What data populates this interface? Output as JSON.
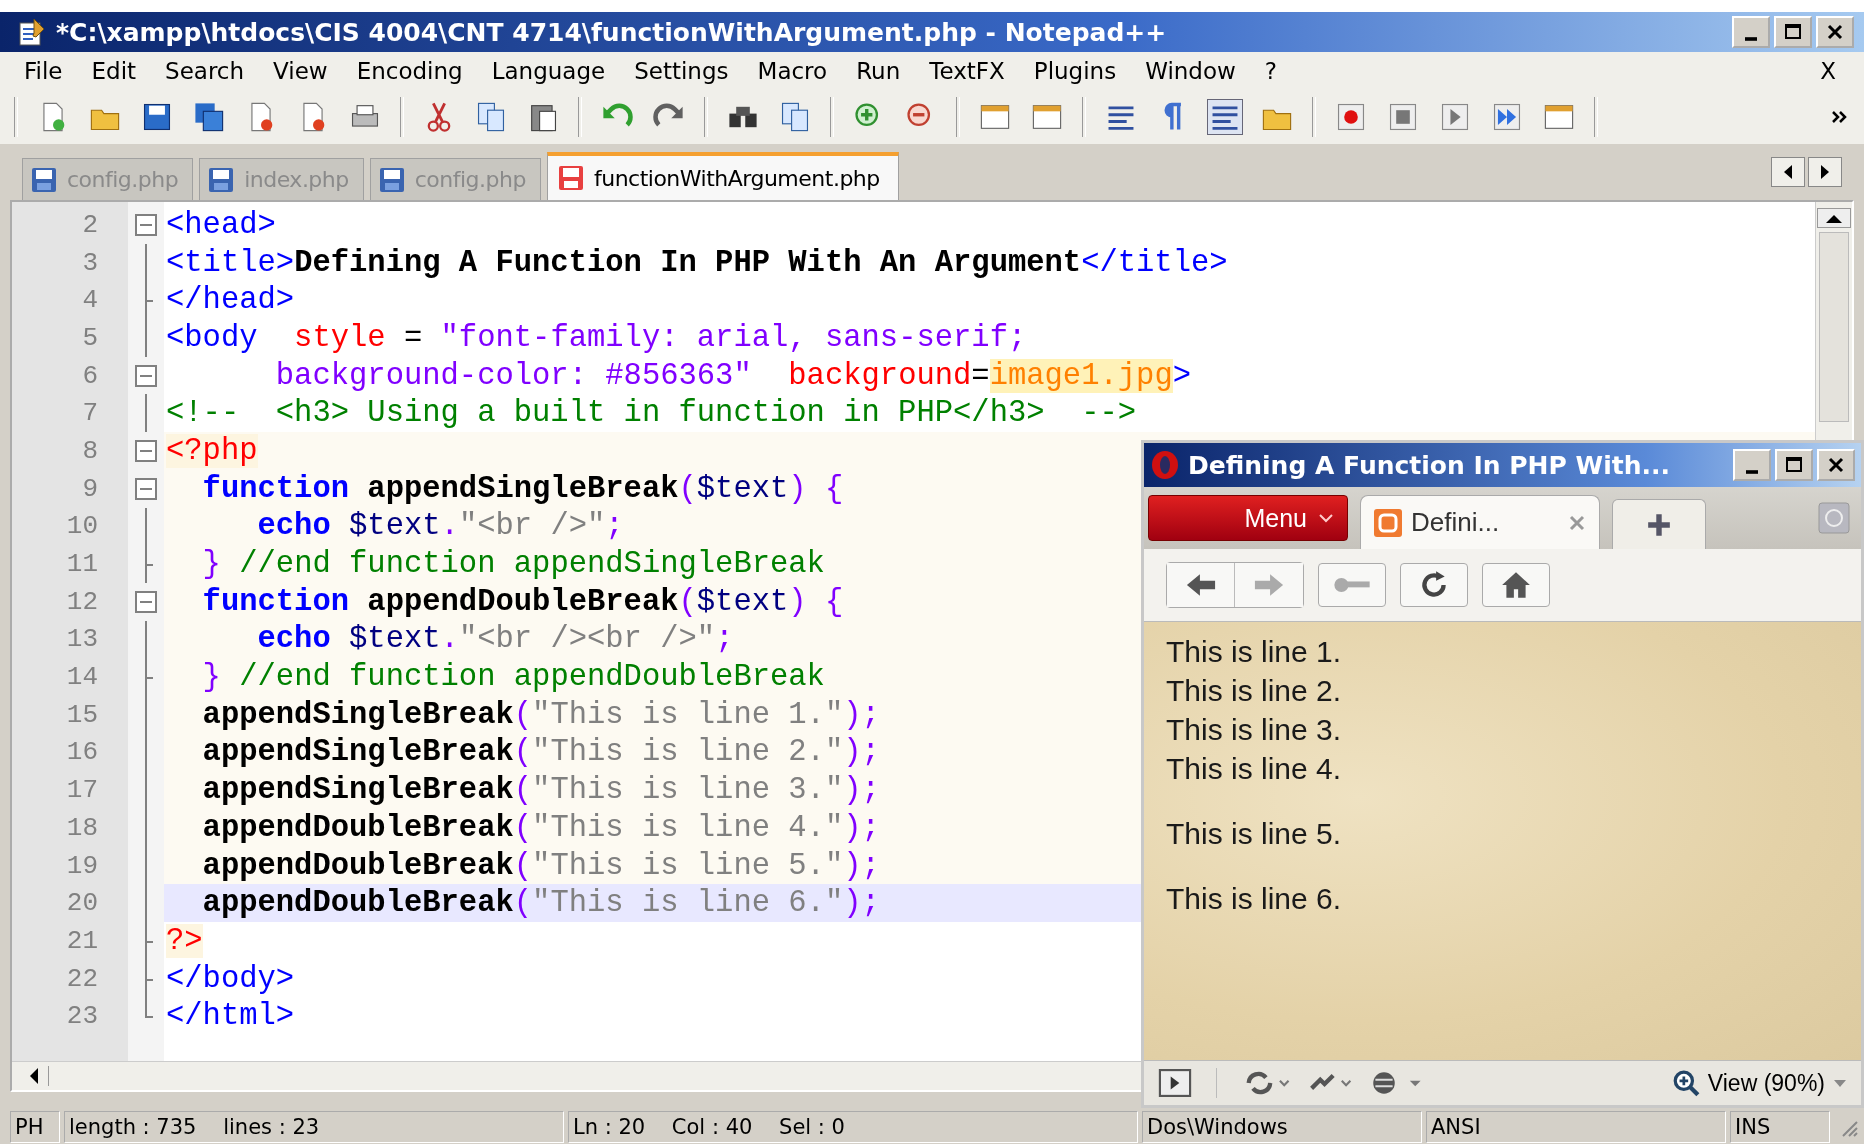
{
  "window": {
    "title": "*C:\\xampp\\htdocs\\CIS 4004\\CNT 4714\\functionWithArgument.php - Notepad++"
  },
  "menu": {
    "items": [
      "File",
      "Edit",
      "Search",
      "View",
      "Encoding",
      "Language",
      "Settings",
      "Macro",
      "Run",
      "TextFX",
      "Plugins",
      "Window",
      "?"
    ],
    "close": "X"
  },
  "tabs": [
    {
      "label": "config.php",
      "selected": false,
      "modified": false
    },
    {
      "label": "index.php",
      "selected": false,
      "modified": false
    },
    {
      "label": "config.php",
      "selected": false,
      "modified": false
    },
    {
      "label": "functionWithArgument.php",
      "selected": true,
      "modified": true
    }
  ],
  "editor": {
    "lines": [
      {
        "number": "2",
        "kind": "fold-start",
        "php": false,
        "selected": false,
        "tokens": [
          {
            "kind": "tag",
            "text": "<head>"
          }
        ]
      },
      {
        "number": "3",
        "kind": "fold-line",
        "php": false,
        "selected": false,
        "tokens": [
          {
            "kind": "tag",
            "text": "<title>"
          },
          {
            "kind": "title",
            "text": "Defining A Function In PHP With An Argument"
          },
          {
            "kind": "tag",
            "text": "</title>"
          }
        ]
      },
      {
        "number": "4",
        "kind": "fold-tick",
        "php": false,
        "selected": false,
        "tokens": [
          {
            "kind": "tag",
            "text": "</head>"
          }
        ]
      },
      {
        "number": "5",
        "kind": "fold-line",
        "php": false,
        "selected": false,
        "tokens": [
          {
            "kind": "tag",
            "text": "<body"
          },
          {
            "kind": "attr",
            "text": "  style"
          },
          {
            "kind": "plain",
            "text": " = "
          },
          {
            "kind": "string",
            "text": "\"font-family: arial, sans-serif;"
          }
        ]
      },
      {
        "number": "6",
        "kind": "fold-start",
        "php": false,
        "selected": false,
        "tokens": [
          {
            "kind": "string",
            "text": "      background-color: #856363\""
          },
          {
            "kind": "attr",
            "text": "  background"
          },
          {
            "kind": "plain",
            "text": "="
          },
          {
            "kind": "value",
            "text": "image1.jpg"
          },
          {
            "kind": "tag",
            "text": ">"
          }
        ]
      },
      {
        "number": "7",
        "kind": "fold-line",
        "php": false,
        "selected": false,
        "tokens": [
          {
            "kind": "comment",
            "text": "<!--  <h3> Using a built in function in PHP</h3>  -->"
          }
        ]
      },
      {
        "number": "8",
        "kind": "fold-start",
        "php": true,
        "selected": false,
        "tokens": [
          {
            "kind": "delim",
            "text": "<?php"
          }
        ]
      },
      {
        "number": "9",
        "kind": "fold-start",
        "php": true,
        "selected": false,
        "tokens": [
          {
            "kind": "keyword",
            "text": "  function"
          },
          {
            "kind": "func",
            "text": " appendSingleBreak"
          },
          {
            "kind": "op",
            "text": "("
          },
          {
            "kind": "var",
            "text": "$text"
          },
          {
            "kind": "op",
            "text": ") {"
          }
        ]
      },
      {
        "number": "10",
        "kind": "fold-line",
        "php": true,
        "selected": false,
        "tokens": [
          {
            "kind": "keyword",
            "text": "     echo"
          },
          {
            "kind": "var",
            "text": " $text"
          },
          {
            "kind": "op",
            "text": "."
          },
          {
            "kind": "phpstring",
            "text": "\"<br />\""
          },
          {
            "kind": "op",
            "text": ";"
          }
        ]
      },
      {
        "number": "11",
        "kind": "fold-tick",
        "php": true,
        "selected": false,
        "tokens": [
          {
            "kind": "op",
            "text": "  }"
          },
          {
            "kind": "comment",
            "text": " //end function appendSingleBreak"
          }
        ]
      },
      {
        "number": "12",
        "kind": "fold-start",
        "php": true,
        "selected": false,
        "tokens": [
          {
            "kind": "keyword",
            "text": "  function"
          },
          {
            "kind": "func",
            "text": " appendDoubleBreak"
          },
          {
            "kind": "op",
            "text": "("
          },
          {
            "kind": "var",
            "text": "$text"
          },
          {
            "kind": "op",
            "text": ") {"
          }
        ]
      },
      {
        "number": "13",
        "kind": "fold-line",
        "php": true,
        "selected": false,
        "tokens": [
          {
            "kind": "keyword",
            "text": "     echo"
          },
          {
            "kind": "var",
            "text": " $text"
          },
          {
            "kind": "op",
            "text": "."
          },
          {
            "kind": "phpstring",
            "text": "\"<br /><br />\""
          },
          {
            "kind": "op",
            "text": ";"
          }
        ]
      },
      {
        "number": "14",
        "kind": "fold-tick",
        "php": true,
        "selected": false,
        "tokens": [
          {
            "kind": "op",
            "text": "  }"
          },
          {
            "kind": "comment",
            "text": " //end function appendDoubleBreak"
          }
        ]
      },
      {
        "number": "15",
        "kind": "fold-line",
        "php": true,
        "selected": false,
        "tokens": [
          {
            "kind": "func",
            "text": "  appendSingleBreak"
          },
          {
            "kind": "op",
            "text": "("
          },
          {
            "kind": "phpstring",
            "text": "\"This is line 1.\""
          },
          {
            "kind": "op",
            "text": ");"
          }
        ]
      },
      {
        "number": "16",
        "kind": "fold-line",
        "php": true,
        "selected": false,
        "tokens": [
          {
            "kind": "func",
            "text": "  appendSingleBreak"
          },
          {
            "kind": "op",
            "text": "("
          },
          {
            "kind": "phpstring",
            "text": "\"This is line 2.\""
          },
          {
            "kind": "op",
            "text": ");"
          }
        ]
      },
      {
        "number": "17",
        "kind": "fold-line",
        "php": true,
        "selected": false,
        "tokens": [
          {
            "kind": "func",
            "text": "  appendSingleBreak"
          },
          {
            "kind": "op",
            "text": "("
          },
          {
            "kind": "phpstring",
            "text": "\"This is line 3.\""
          },
          {
            "kind": "op",
            "text": ");"
          }
        ]
      },
      {
        "number": "18",
        "kind": "fold-line",
        "php": true,
        "selected": false,
        "tokens": [
          {
            "kind": "func",
            "text": "  appendDoubleBreak"
          },
          {
            "kind": "op",
            "text": "("
          },
          {
            "kind": "phpstring",
            "text": "\"This is line 4.\""
          },
          {
            "kind": "op",
            "text": ");"
          }
        ]
      },
      {
        "number": "19",
        "kind": "fold-line",
        "php": true,
        "selected": false,
        "tokens": [
          {
            "kind": "func",
            "text": "  appendDoubleBreak"
          },
          {
            "kind": "op",
            "text": "("
          },
          {
            "kind": "phpstring",
            "text": "\"This is line 5.\""
          },
          {
            "kind": "op",
            "text": ");"
          }
        ]
      },
      {
        "number": "20",
        "kind": "fold-line",
        "php": true,
        "selected": true,
        "tokens": [
          {
            "kind": "func",
            "text": "  appendDoubleBreak"
          },
          {
            "kind": "op",
            "text": "("
          },
          {
            "kind": "phpstring",
            "text": "\"This is line 6.\""
          },
          {
            "kind": "op",
            "text": ");"
          }
        ]
      },
      {
        "number": "21",
        "kind": "fold-tick",
        "php": false,
        "selected": false,
        "tokens": [
          {
            "kind": "delim",
            "text": "?>"
          }
        ]
      },
      {
        "number": "22",
        "kind": "fold-tick",
        "php": false,
        "selected": false,
        "tokens": [
          {
            "kind": "tag",
            "text": "</body>"
          }
        ]
      },
      {
        "number": "23",
        "kind": "fold-end",
        "php": false,
        "selected": false,
        "tokens": [
          {
            "kind": "tag",
            "text": "</html>"
          }
        ]
      }
    ]
  },
  "browser": {
    "title": "Defining A Function In PHP With...",
    "menu_button": "Menu",
    "tab": {
      "label": "Defini..."
    },
    "page_lines": [
      {
        "text": "This is line 1.",
        "gap_after": false
      },
      {
        "text": "This is line 2.",
        "gap_after": false
      },
      {
        "text": "This is line 3.",
        "gap_after": false
      },
      {
        "text": "This is line 4.",
        "gap_after": true
      },
      {
        "text": "This is line 5.",
        "gap_after": true
      },
      {
        "text": "This is line 6.",
        "gap_after": false
      }
    ],
    "zoom": "View (90%)"
  },
  "status_bar": {
    "type": "PH",
    "length": "length : 735    lines : 23",
    "position": "Ln : 20    Col : 40    Sel : 0",
    "eol": "Dos\\Windows",
    "encoding": "ANSI",
    "mode": "INS"
  }
}
